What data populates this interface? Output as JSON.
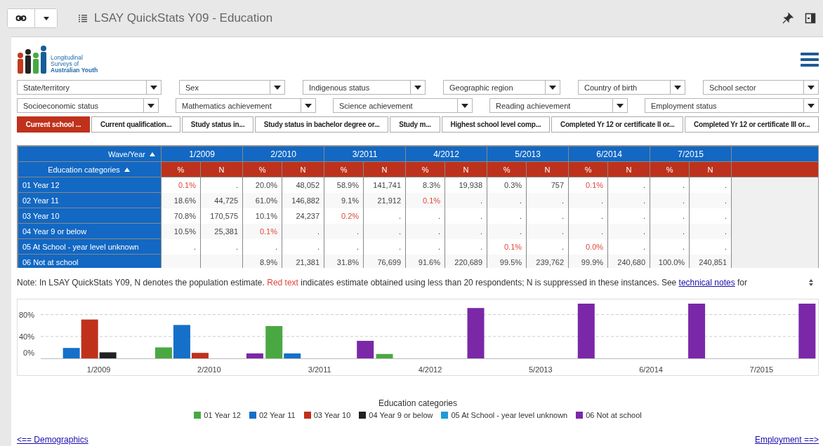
{
  "window": {
    "title": "LSAY QuickStats Y09 - Education"
  },
  "logo": {
    "lines": [
      "Longitudinal",
      "Surveys of",
      "Australian Youth"
    ]
  },
  "filters": [
    [
      {
        "label": "State/territory"
      },
      {
        "label": "Sex"
      },
      {
        "label": "Indigenous status"
      },
      {
        "label": "Geographic region"
      },
      {
        "label": "Country of birth"
      },
      {
        "label": "School sector"
      }
    ],
    [
      {
        "label": "Socioeconomic status"
      },
      {
        "label": "Mathematics achievement"
      },
      {
        "label": "Science achievement"
      },
      {
        "label": "Reading achievement"
      },
      {
        "label": "Employment status"
      }
    ]
  ],
  "tabs": [
    {
      "label": "Current school ...",
      "selected": true
    },
    {
      "label": "Current qualification...",
      "selected": false
    },
    {
      "label": "Study status in...",
      "selected": false
    },
    {
      "label": "Study status in bachelor degree or...",
      "selected": false
    },
    {
      "label": "Study m...",
      "selected": false
    },
    {
      "label": "Highest school level comp...",
      "selected": false
    },
    {
      "label": "Completed Yr 12 or certificate II or...",
      "selected": false
    },
    {
      "label": "Completed Yr 12 or certificate III or...",
      "selected": false
    }
  ],
  "table": {
    "column_header": "Wave/Year",
    "row_header": "Education categories",
    "waves": [
      {
        "label": "1/2009",
        "subcolumns": [
          "%",
          "N"
        ]
      },
      {
        "label": "2/2010",
        "subcolumns": [
          "%",
          "N"
        ]
      },
      {
        "label": "3/2011",
        "subcolumns": [
          "%",
          "N"
        ]
      },
      {
        "label": "4/2012",
        "subcolumns": [
          "%",
          "N"
        ]
      },
      {
        "label": "5/2013",
        "subcolumns": [
          "%",
          "N"
        ]
      },
      {
        "label": "6/2014",
        "subcolumns": [
          "%",
          "N"
        ]
      },
      {
        "label": "7/2015",
        "subcolumns": [
          "%",
          "N"
        ]
      }
    ],
    "rows": [
      {
        "label": "01 Year 12",
        "cells": [
          {
            "text": "0.1%",
            "flagged": true
          },
          {
            "text": "."
          },
          {
            "text": "20.0%",
            "flagged": false
          },
          {
            "text": "48,052",
            "flagged": false
          },
          {
            "text": "58.9%",
            "flagged": false
          },
          {
            "text": "141,741",
            "flagged": false
          },
          {
            "text": "8.3%",
            "flagged": false
          },
          {
            "text": "19,938",
            "flagged": false
          },
          {
            "text": "0.3%",
            "flagged": false
          },
          {
            "text": "757",
            "flagged": false
          },
          {
            "text": "0.1%",
            "flagged": true
          },
          {
            "text": "."
          },
          {
            "text": "."
          },
          {
            "text": "."
          }
        ]
      },
      {
        "label": "02 Year 11",
        "cells": [
          {
            "text": "18.6%",
            "flagged": false
          },
          {
            "text": "44,725",
            "flagged": false
          },
          {
            "text": "61.0%",
            "flagged": false
          },
          {
            "text": "146,882",
            "flagged": false
          },
          {
            "text": "9.1%",
            "flagged": false
          },
          {
            "text": "21,912",
            "flagged": false
          },
          {
            "text": "0.1%",
            "flagged": true
          },
          {
            "text": "."
          },
          {
            "text": "."
          },
          {
            "text": "."
          },
          {
            "text": "."
          },
          {
            "text": "."
          },
          {
            "text": "."
          },
          {
            "text": "."
          }
        ]
      },
      {
        "label": "03 Year 10",
        "cells": [
          {
            "text": "70.8%",
            "flagged": false
          },
          {
            "text": "170,575",
            "flagged": false
          },
          {
            "text": "10.1%",
            "flagged": false
          },
          {
            "text": "24,237",
            "flagged": false
          },
          {
            "text": "0.2%",
            "flagged": true
          },
          {
            "text": "."
          },
          {
            "text": "."
          },
          {
            "text": "."
          },
          {
            "text": "."
          },
          {
            "text": "."
          },
          {
            "text": "."
          },
          {
            "text": "."
          },
          {
            "text": "."
          },
          {
            "text": "."
          }
        ]
      },
      {
        "label": "04 Year 9 or below",
        "cells": [
          {
            "text": "10.5%",
            "flagged": false
          },
          {
            "text": "25,381",
            "flagged": false
          },
          {
            "text": "0.1%",
            "flagged": true
          },
          {
            "text": "."
          },
          {
            "text": "."
          },
          {
            "text": "."
          },
          {
            "text": "."
          },
          {
            "text": "."
          },
          {
            "text": "."
          },
          {
            "text": "."
          },
          {
            "text": "."
          },
          {
            "text": "."
          },
          {
            "text": "."
          },
          {
            "text": "."
          }
        ]
      },
      {
        "label": "05 At School - year level unknown",
        "cells": [
          {
            "text": "."
          },
          {
            "text": "."
          },
          {
            "text": "."
          },
          {
            "text": "."
          },
          {
            "text": "."
          },
          {
            "text": "."
          },
          {
            "text": "."
          },
          {
            "text": "."
          },
          {
            "text": "0.1%",
            "flagged": true
          },
          {
            "text": "."
          },
          {
            "text": "0.0%",
            "flagged": true
          },
          {
            "text": "."
          },
          {
            "text": "."
          },
          {
            "text": "."
          }
        ]
      },
      {
        "label": "06 Not at school",
        "cells": [
          null,
          null,
          {
            "text": "8.9%",
            "flagged": false
          },
          {
            "text": "21,381",
            "flagged": false
          },
          {
            "text": "31.8%",
            "flagged": false
          },
          {
            "text": "76,699",
            "flagged": false
          },
          {
            "text": "91.6%",
            "flagged": false
          },
          {
            "text": "220,689",
            "flagged": false
          },
          {
            "text": "99.5%",
            "flagged": false
          },
          {
            "text": "239,762",
            "flagged": false
          },
          {
            "text": "99.9%",
            "flagged": false
          },
          {
            "text": "240,680",
            "flagged": false
          },
          {
            "text": "100.0%",
            "flagged": false
          },
          {
            "text": "240,851",
            "flagged": false
          }
        ]
      }
    ]
  },
  "note": {
    "before": "Note: In LSAY QuickStats Y09, N denotes the population estimate. ",
    "highlight": "Red text",
    "after": " indicates estimate obtained using less than 20 respondents; N is suppressed in these instances. See ",
    "link": "technical notes",
    "end": " for"
  },
  "chart": {
    "chart_data": {
      "type": "bar",
      "xlabel": "Education categories",
      "categories": [
        "1/2009",
        "2/2010",
        "3/2011",
        "4/2012",
        "5/2013",
        "6/2014",
        "7/2015"
      ],
      "ylim": [
        0,
        100
      ],
      "yticks": [
        {
          "value": 0,
          "label": "0%"
        },
        {
          "value": 40,
          "label": "40%"
        },
        {
          "value": 80,
          "label": "80%"
        }
      ],
      "series": [
        {
          "name": "01 Year 12",
          "color": "#4aa843",
          "values": [
            0,
            20,
            59,
            8,
            0,
            0,
            null
          ]
        },
        {
          "name": "02 Year 11",
          "color": "#1570c9",
          "values": [
            19,
            61,
            9,
            0,
            null,
            null,
            null
          ]
        },
        {
          "name": "03 Year 10",
          "color": "#c0311c",
          "values": [
            71,
            10,
            0,
            null,
            null,
            null,
            null
          ]
        },
        {
          "name": "04 Year 9 or below",
          "color": "#222222",
          "values": [
            11,
            0,
            null,
            null,
            null,
            null,
            null
          ]
        },
        {
          "name": "05 At School - year level unknown",
          "color": "#1e9ad6",
          "values": [
            null,
            null,
            null,
            null,
            0,
            0,
            null
          ]
        },
        {
          "name": "06 Not at school",
          "color": "#7a27a8",
          "values": [
            null,
            9,
            32,
            92,
            100,
            100,
            100
          ]
        }
      ]
    }
  },
  "links": {
    "previous": "<== Demographics",
    "next": "Employment ==>"
  }
}
